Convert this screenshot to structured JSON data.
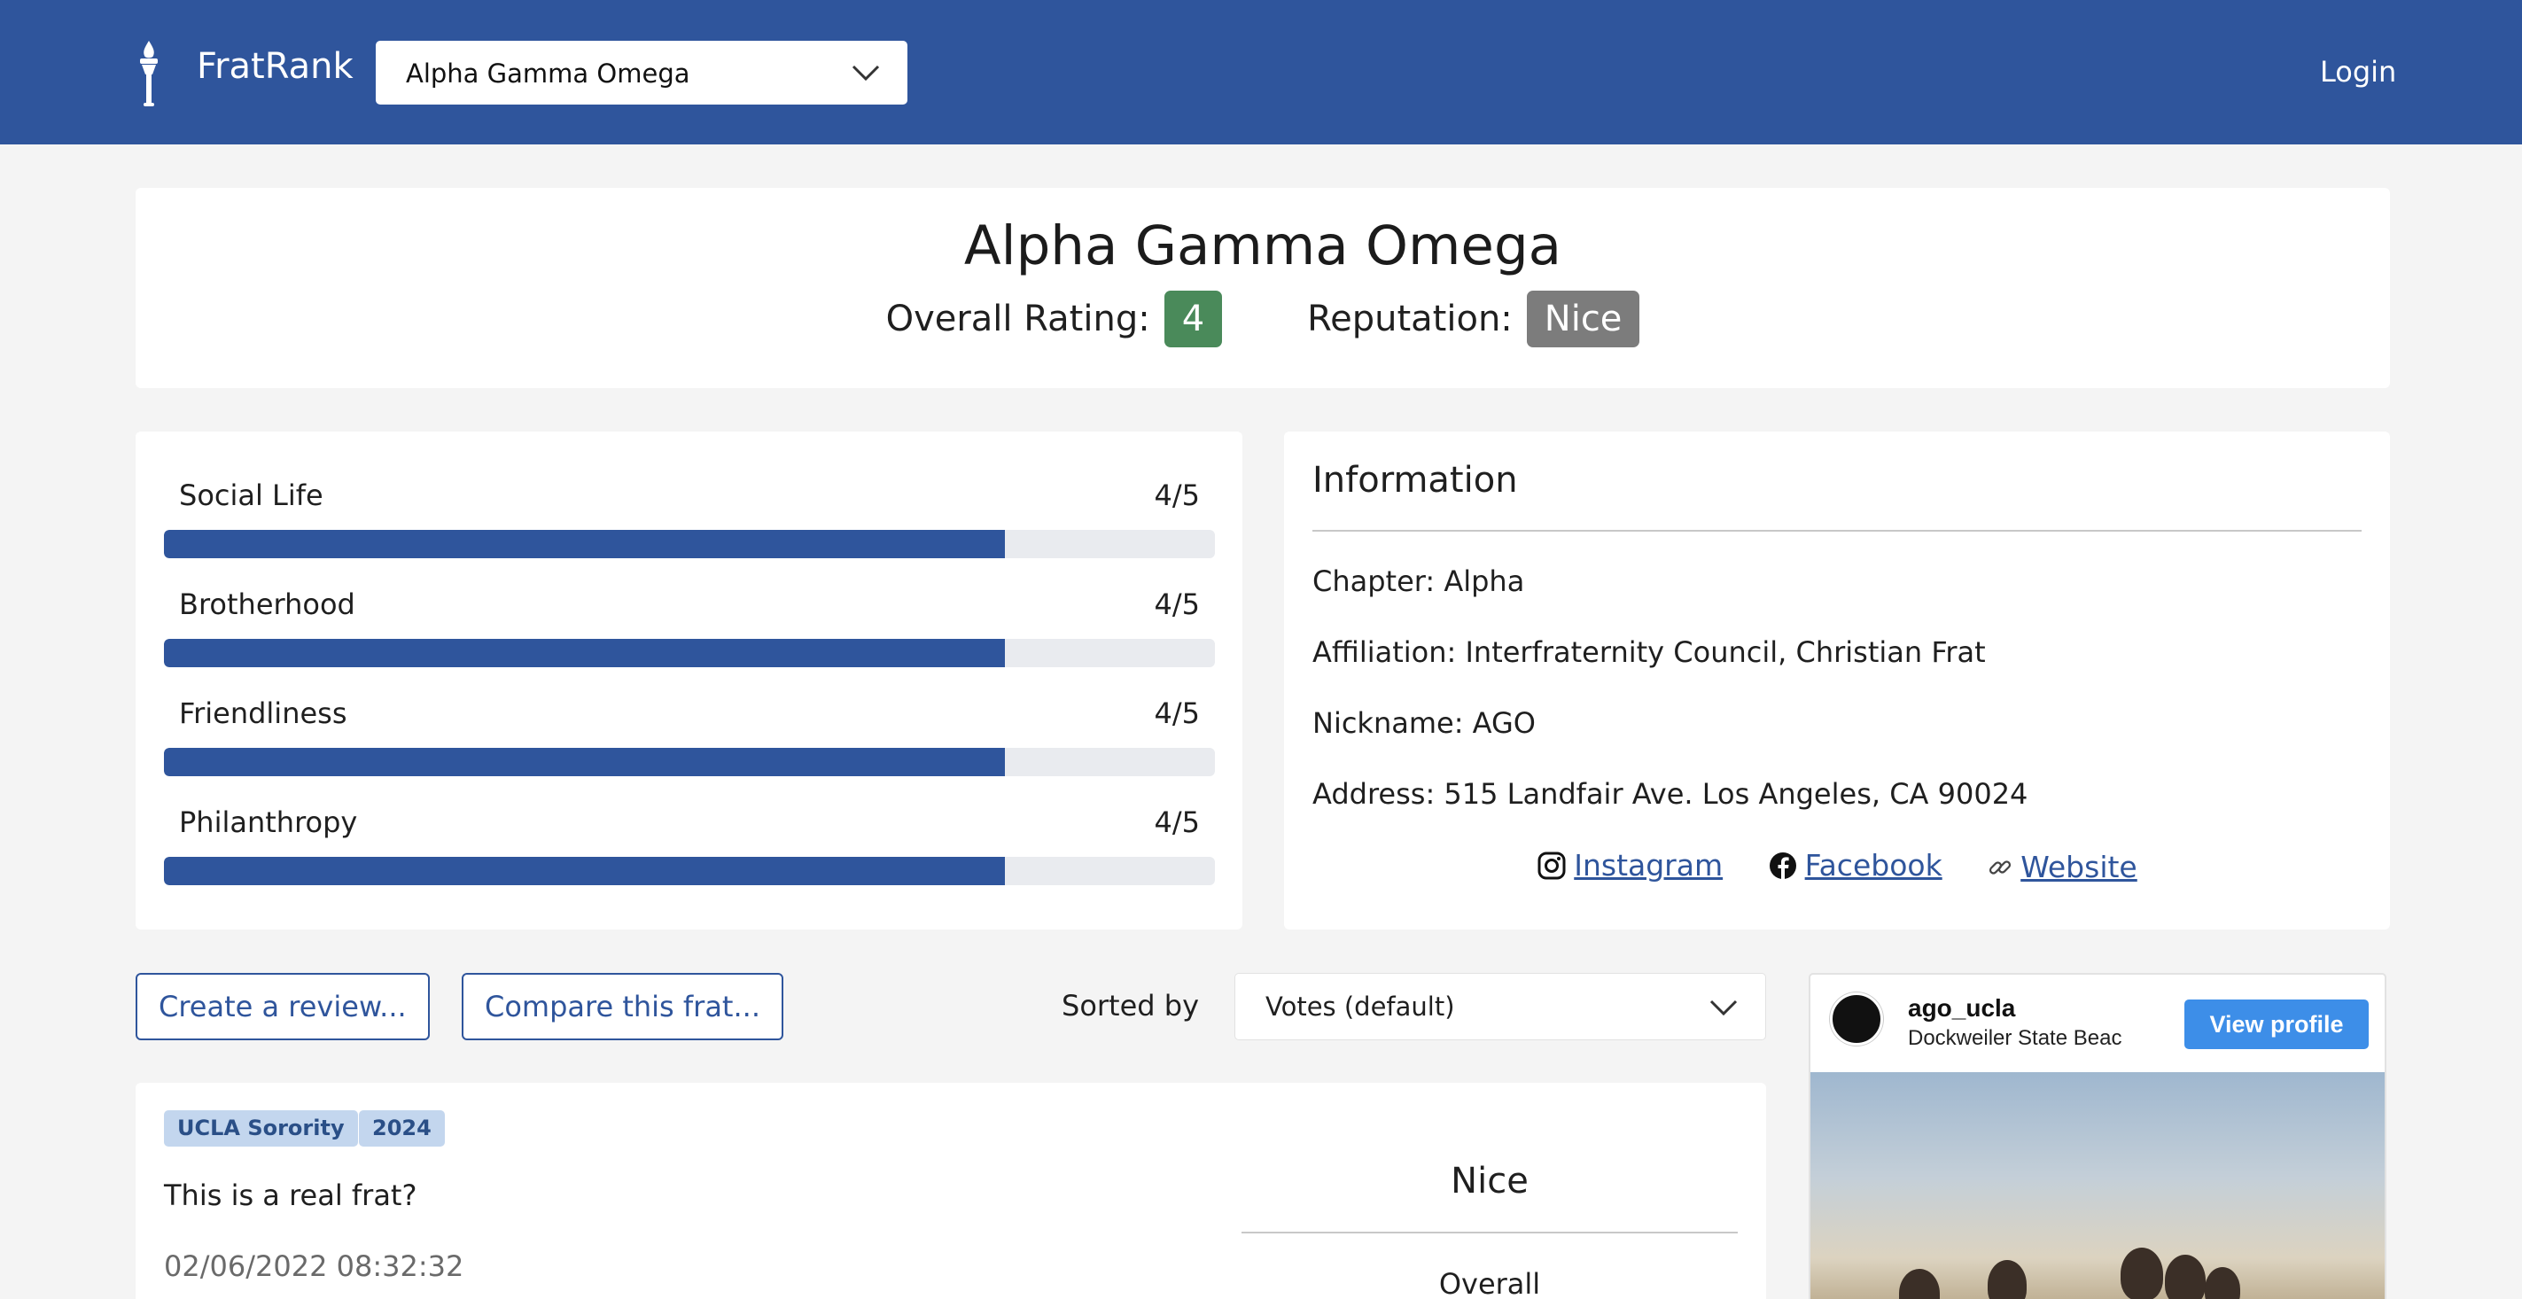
{
  "header": {
    "brand": "FratRank",
    "frat_selector_value": "Alpha Gamma Omega",
    "login_label": "Login"
  },
  "summary": {
    "title": "Alpha Gamma Omega",
    "overall_rating_label": "Overall Rating:",
    "overall_rating_value": "4",
    "reputation_label": "Reputation:",
    "reputation_value": "Nice"
  },
  "scores": [
    {
      "label": "Social Life",
      "value": "4/5",
      "fraction": 0.8
    },
    {
      "label": "Brotherhood",
      "value": "4/5",
      "fraction": 0.8
    },
    {
      "label": "Friendliness",
      "value": "4/5",
      "fraction": 0.8
    },
    {
      "label": "Philanthropy",
      "value": "4/5",
      "fraction": 0.8
    }
  ],
  "information": {
    "title": "Information",
    "chapter": "Chapter: Alpha",
    "affiliation": "Affiliation: Interfraternity Council, Christian Frat",
    "nickname": "Nickname: AGO",
    "address": "Address: 515 Landfair Ave. Los Angeles, CA 90024",
    "links": {
      "instagram": "Instagram",
      "facebook": "Facebook",
      "website": "Website"
    }
  },
  "controls": {
    "create_review": "Create a review...",
    "compare": "Compare this frat...",
    "sorted_by_label": "Sorted by",
    "sort_value": "Votes (default)"
  },
  "review": {
    "tags": [
      "UCLA Sorority",
      "2024"
    ],
    "text": "This is a real frat?",
    "timestamp": "02/06/2022 08:32:32",
    "reputation": "Nice",
    "overall_label": "Overall"
  },
  "instagram_embed": {
    "handle": "ago_ucla",
    "location": "Dockweiler State Beac",
    "view_profile": "View profile"
  },
  "colors": {
    "brand_blue": "#2f559c",
    "rating_green": "#4a8a5a",
    "reputation_gray": "#7c7c7c",
    "tag_bg": "#c3d6ee",
    "ig_button": "#3d8ee8"
  }
}
